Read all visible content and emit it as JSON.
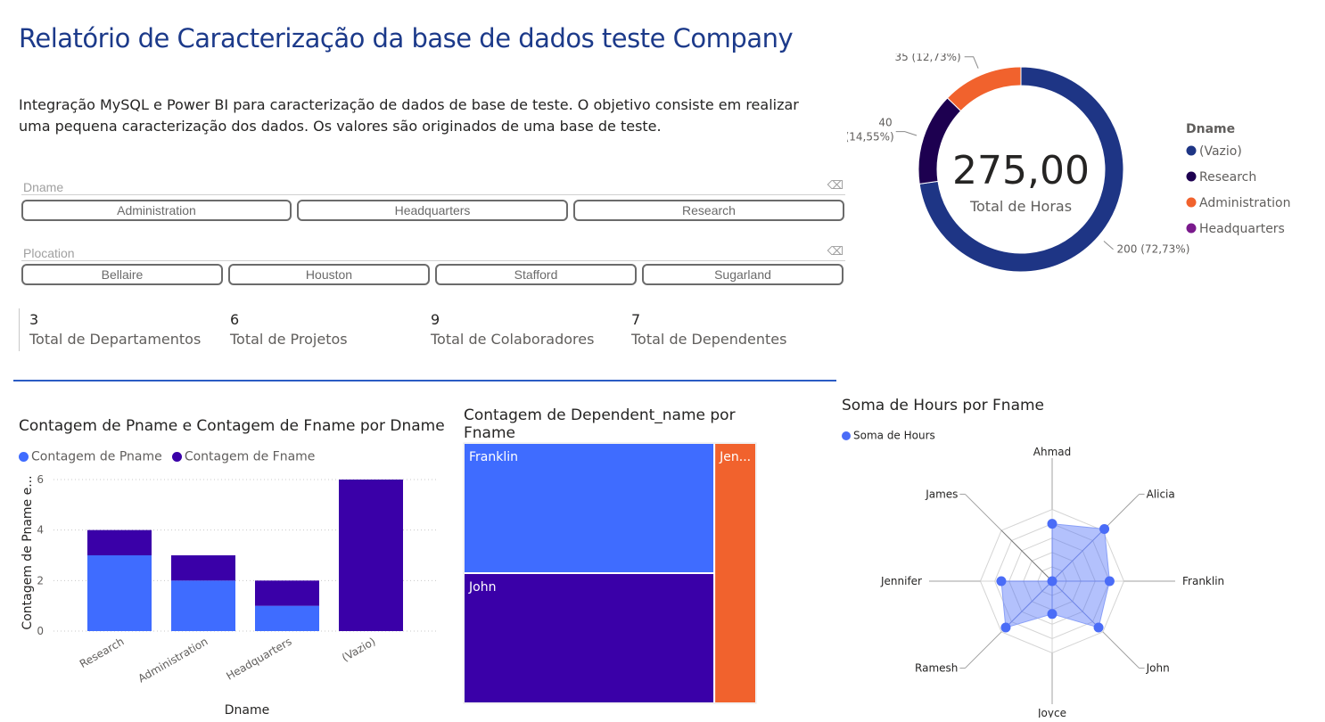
{
  "header": {
    "title": "Relatório de Caracterização da base de dados teste Company",
    "description": "Integração MySQL e Power BI para caracterização de dados de base de teste. O objetivo consiste em realizar uma pequena caracterização dos dados. Os valores são originados de uma base de teste."
  },
  "slicers": {
    "dname": {
      "label": "Dname",
      "options": [
        "Administration",
        "Headquarters",
        "Research"
      ]
    },
    "plocation": {
      "label": "Plocation",
      "options": [
        "Bellaire",
        "Houston",
        "Stafford",
        "Sugarland"
      ]
    }
  },
  "cards": [
    {
      "value": "3",
      "label": "Total de Departamentos"
    },
    {
      "value": "6",
      "label": "Total de Projetos"
    },
    {
      "value": "9",
      "label": "Total de Colaboradores"
    },
    {
      "value": "7",
      "label": "Total de Dependentes"
    }
  ],
  "colors": {
    "title_blue": "#1c3a8a",
    "bar_light": "#3f6cff",
    "bar_dark": "#3a00a8",
    "donut_vazio": "#1e3585",
    "donut_research": "#1d0050",
    "donut_admin": "#f1622d",
    "donut_hq": "#7a1a8c",
    "treemap_orange": "#f1622d",
    "radar": "#4a6cf7",
    "divider": "#2b5cc4"
  },
  "chart_data": [
    {
      "type": "pie",
      "variant": "donut",
      "center_value": "275,00",
      "center_label": "Total de Horas",
      "legend_title": "Dname",
      "categories": [
        "(Vazio)",
        "Research",
        "Administration",
        "Headquarters"
      ],
      "values": [
        200,
        40,
        35,
        0
      ],
      "data_labels": [
        "200 (72,73%)",
        "40 (14,55%)",
        "35 (12,73%)",
        ""
      ]
    },
    {
      "type": "bar",
      "stacked": true,
      "title": "Contagem de Pname e Contagem de Fname por Dname",
      "xlabel": "Dname",
      "ylabel": "Contagem de Pname e...",
      "categories": [
        "Research",
        "Administration",
        "Headquarters",
        "(Vazio)"
      ],
      "series": [
        {
          "name": "Contagem de Pname",
          "values": [
            3,
            2,
            1,
            0
          ]
        },
        {
          "name": "Contagem de Fname",
          "values": [
            1,
            1,
            1,
            6
          ]
        }
      ],
      "yticks": [
        "0",
        "2",
        "4",
        "6"
      ],
      "ylim": [
        0,
        6
      ],
      "grid": true,
      "legend_position": "top-left"
    },
    {
      "type": "treemap",
      "title": "Contagem de Dependent_name por Fname",
      "categories": [
        "Franklin",
        "John",
        "Jen..."
      ],
      "values": [
        3,
        3,
        1
      ]
    },
    {
      "type": "radar",
      "title": "Soma de Hours por Fname",
      "series_name": "Soma de Hours",
      "categories": [
        "Ahmad",
        "Alicia",
        "Franklin",
        "John",
        "Joyce",
        "Ramesh",
        "Jennifer",
        "James"
      ],
      "values": [
        35,
        45,
        35,
        40,
        20,
        40,
        31,
        0
      ],
      "rmax": 50
    }
  ]
}
